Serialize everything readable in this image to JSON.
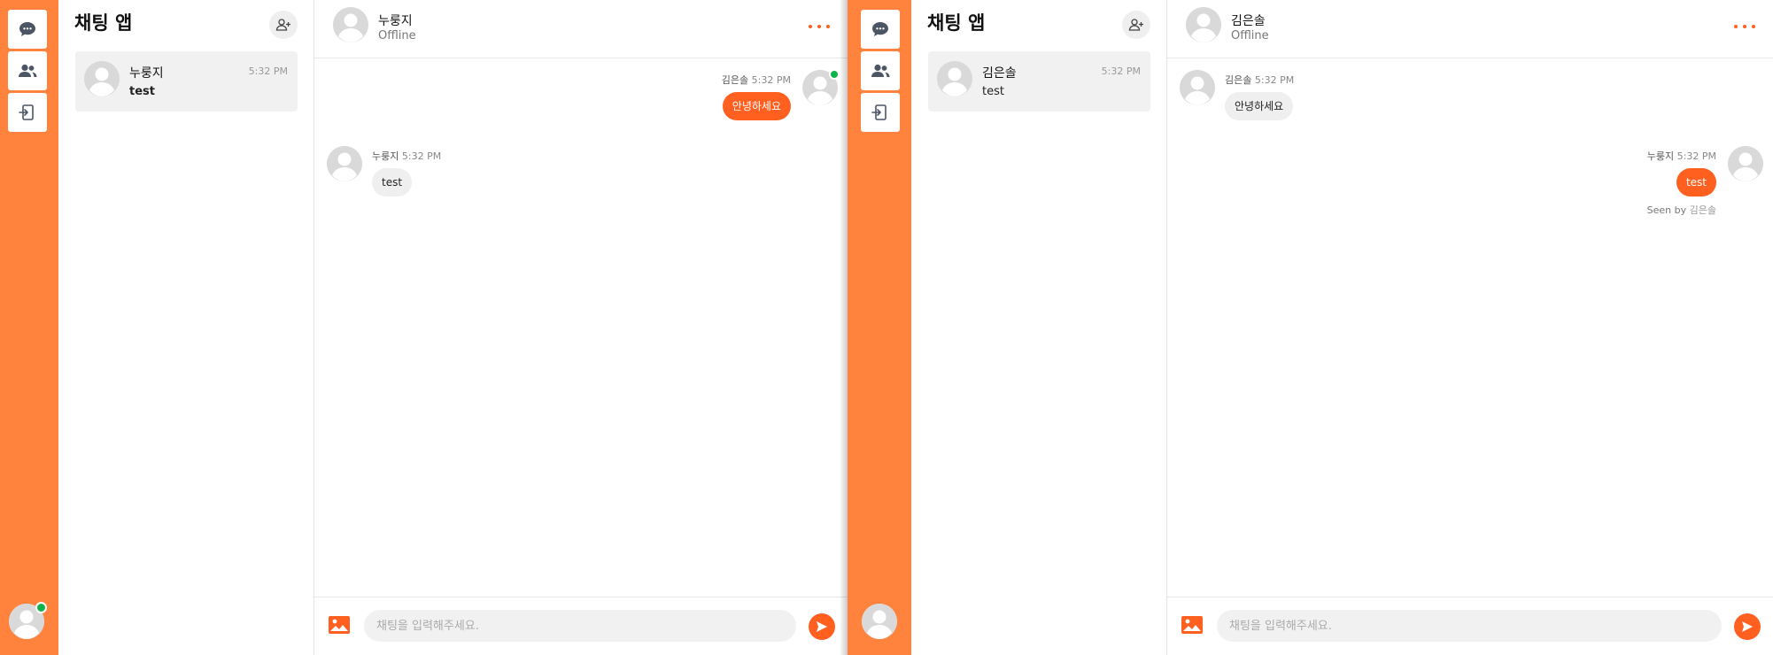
{
  "colors": {
    "accent": "#ff5f1f",
    "rail": "#ff823d",
    "online": "#10b34a"
  },
  "left": {
    "list_title": "채팅 앱",
    "conversations": [
      {
        "name": "누룽지",
        "time": "5:32 PM",
        "preview": "test"
      }
    ],
    "chat": {
      "name": "누룽지",
      "status": "Offline",
      "messages": [
        {
          "sender": "김은솔",
          "time": "5:32 PM",
          "text": "안녕하세요"
        },
        {
          "sender": "누룽지",
          "time": "5:32 PM",
          "text": "test"
        }
      ],
      "input_placeholder": "채팅을 입력해주세요."
    }
  },
  "right": {
    "list_title": "채팅 앱",
    "conversations": [
      {
        "name": "김은솔",
        "time": "5:32 PM",
        "preview": "test"
      }
    ],
    "chat": {
      "name": "김은솔",
      "status": "Offline",
      "messages": [
        {
          "sender": "김은솔",
          "time": "5:32 PM",
          "text": "안녕하세요"
        },
        {
          "sender": "누룽지",
          "time": "5:32 PM",
          "text": "test",
          "seen_prefix": "Seen by",
          "seen_by": "김은솔"
        }
      ],
      "input_placeholder": "채팅을 입력해주세요."
    }
  },
  "icons": {
    "rail": [
      "chat-bubble-icon",
      "users-icon",
      "logout-icon"
    ],
    "add": "user-plus-icon",
    "more": "more-dots-icon",
    "image": "image-icon",
    "send": "send-icon"
  }
}
